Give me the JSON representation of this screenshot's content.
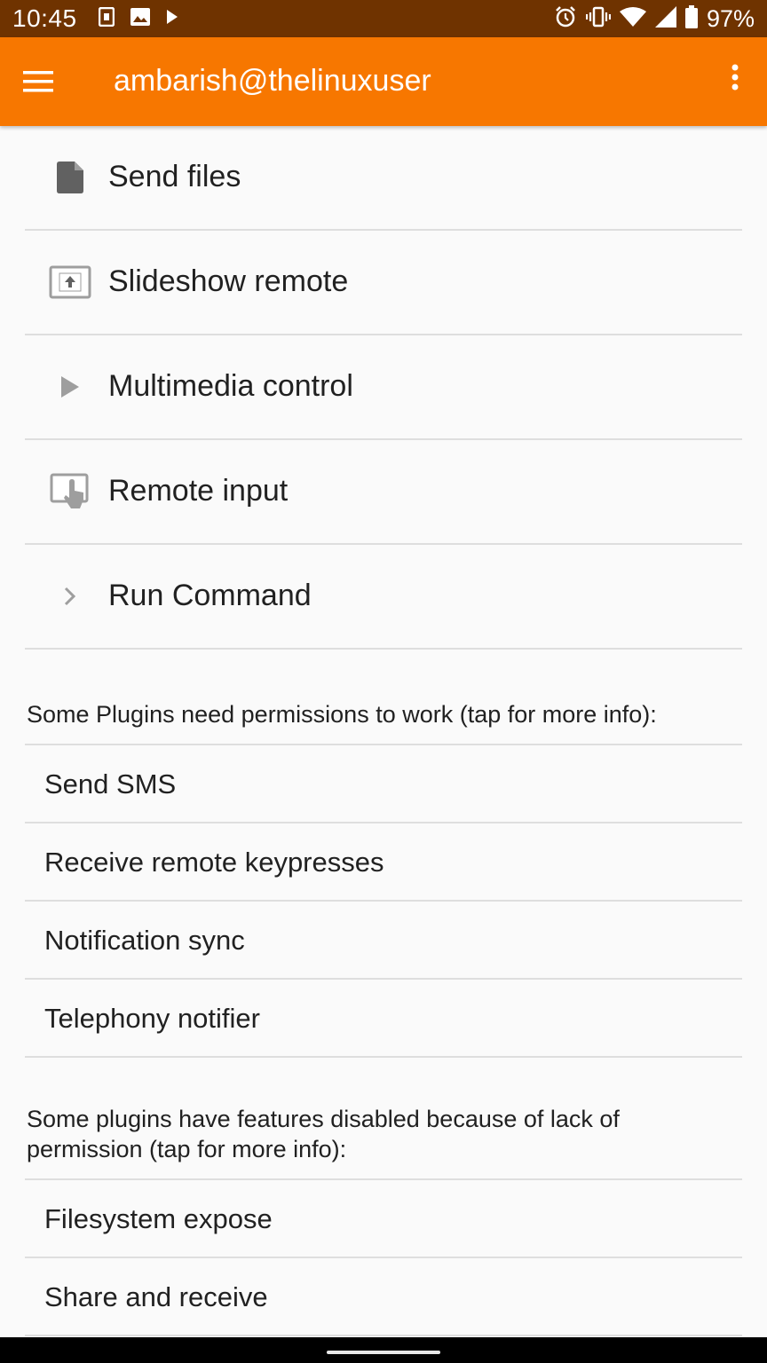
{
  "status_bar": {
    "time": "10:45",
    "battery": "97%",
    "left_icons": [
      "sim-icon",
      "image-icon",
      "play-icon"
    ],
    "right_icons": [
      "alarm-icon",
      "vibrate-icon",
      "wifi-icon",
      "signal-icon",
      "battery-icon"
    ]
  },
  "app_bar": {
    "title": "ambarish@thelinuxuser",
    "background": "#f77700"
  },
  "plugins": [
    {
      "label": "Send files",
      "icon": "file-icon"
    },
    {
      "label": "Slideshow remote",
      "icon": "slideshow-icon"
    },
    {
      "label": "Multimedia control",
      "icon": "play-icon"
    },
    {
      "label": "Remote input",
      "icon": "touch-input-icon"
    },
    {
      "label": "Run Command",
      "icon": "chevron-right-icon"
    }
  ],
  "permission_section": {
    "header": "Some Plugins need permissions to work (tap for more info):",
    "items": [
      "Send SMS",
      "Receive remote keypresses",
      "Notification sync",
      "Telephony notifier"
    ]
  },
  "disabled_section": {
    "header": "Some plugins have features disabled because of lack of permission (tap for more info):",
    "items": [
      "Filesystem expose",
      "Share and receive"
    ]
  }
}
